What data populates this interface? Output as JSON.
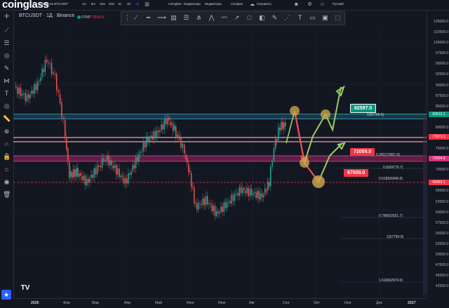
{
  "brand": {
    "logo_text": "coinglass"
  },
  "toolbar": {
    "pair": "Binance BTCUSDT",
    "intervals": [
      "1m",
      "5m",
      "15m",
      "30m",
      "1H",
      "4H",
      "1Д"
    ],
    "indicators": "Coinglass - Индикаторы",
    "indicators2": "Индикаторы",
    "compare": "Compare",
    "save": "Сохранить",
    "language": "Русский"
  },
  "chart_header": {
    "symbol": "BTCUSDT · 1Д · Binance",
    "open_label": "ОТКР",
    "open_value": "78549.6"
  },
  "price_axis": {
    "labels": [
      "105000.0",
      "102500.0",
      "100000.0",
      "97500.0",
      "95000.0",
      "92500.0",
      "90000.0",
      "87500.0",
      "85000.0",
      "80000.0",
      "75000.0",
      "70000.0",
      "65000.0",
      "62500.0",
      "60000.0",
      "57500.0",
      "55000.0",
      "52500.0",
      "50000.0",
      "47500.0",
      "45000.0",
      "42500.0"
    ],
    "tags": [
      {
        "text": "82812.1",
        "color": "#089981"
      },
      {
        "text": "77671.1",
        "color": "#f23645"
      },
      {
        "text": "72504.9",
        "color": "#d6337c"
      },
      {
        "text": "66863.1",
        "color": "#f23645"
      }
    ]
  },
  "time_axis": {
    "labels": [
      "2026",
      "Фев",
      "Мар",
      "Апр",
      "Май",
      "Июн",
      "Июл",
      "Авг",
      "Сен",
      "Окт",
      "Ноя",
      "Дек",
      "2027"
    ]
  },
  "fib_labels": [
    {
      "text": "1(81796.5)",
      "color": "#089981"
    },
    {
      "text": "0.382(72607.9)",
      "color": "#f23645"
    },
    {
      "text": "0.5(69779.7)",
      "color": "#4caf50"
    },
    {
      "text": "0.618(66949.6)",
      "color": "#089981"
    },
    {
      "text": "0.786(62921.7)",
      "color": "#2196f3"
    },
    {
      "text": "1(57790.9)",
      "color": "#787b86"
    },
    {
      "text": "1.618(42974.0)",
      "color": "#2962ff"
    }
  ],
  "callouts": [
    {
      "text": "82597.5",
      "color": "#089981"
    },
    {
      "text": "72000.0",
      "color": "#f23645"
    },
    {
      "text": "67000.0",
      "color": "#f23645"
    }
  ],
  "colors": {
    "bg": "#131722",
    "up": "#26a69a",
    "down": "#ef5350",
    "green_arrow": "#9ccc65",
    "red_arrow": "#ef5350"
  },
  "tv_badge": "TV"
}
